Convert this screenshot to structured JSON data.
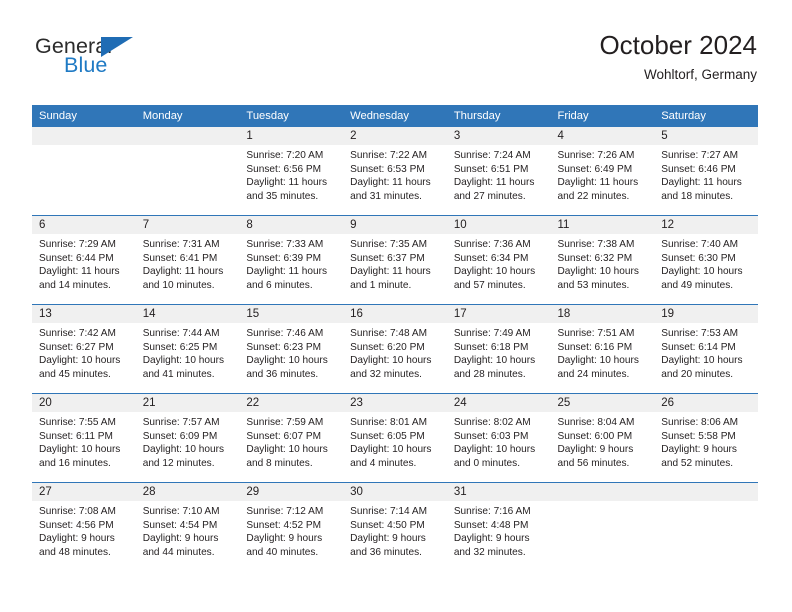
{
  "brand": {
    "line1": "General",
    "line2": "Blue",
    "triangle_color": "#1f6cb4",
    "blue_color": "#1f7ac4"
  },
  "header": {
    "title": "October 2024",
    "subtitle": "Wohltorf, Germany"
  },
  "theme": {
    "header_bg": "#3076b8",
    "daynum_bg": "#f0f0f0",
    "text": "#231f20"
  },
  "weekday_headers": [
    "Sunday",
    "Monday",
    "Tuesday",
    "Wednesday",
    "Thursday",
    "Friday",
    "Saturday"
  ],
  "labels": {
    "sunrise_prefix": "Sunrise:",
    "sunset_prefix": "Sunset:",
    "daylight_prefix": "Daylight:"
  },
  "weeks": [
    [
      {
        "day": "",
        "sunrise": "",
        "sunset": "",
        "daylight_1": "",
        "daylight_2": ""
      },
      {
        "day": "",
        "sunrise": "",
        "sunset": "",
        "daylight_1": "",
        "daylight_2": ""
      },
      {
        "day": "1",
        "sunrise": "Sunrise: 7:20 AM",
        "sunset": "Sunset: 6:56 PM",
        "daylight_1": "Daylight: 11 hours",
        "daylight_2": "and 35 minutes."
      },
      {
        "day": "2",
        "sunrise": "Sunrise: 7:22 AM",
        "sunset": "Sunset: 6:53 PM",
        "daylight_1": "Daylight: 11 hours",
        "daylight_2": "and 31 minutes."
      },
      {
        "day": "3",
        "sunrise": "Sunrise: 7:24 AM",
        "sunset": "Sunset: 6:51 PM",
        "daylight_1": "Daylight: 11 hours",
        "daylight_2": "and 27 minutes."
      },
      {
        "day": "4",
        "sunrise": "Sunrise: 7:26 AM",
        "sunset": "Sunset: 6:49 PM",
        "daylight_1": "Daylight: 11 hours",
        "daylight_2": "and 22 minutes."
      },
      {
        "day": "5",
        "sunrise": "Sunrise: 7:27 AM",
        "sunset": "Sunset: 6:46 PM",
        "daylight_1": "Daylight: 11 hours",
        "daylight_2": "and 18 minutes."
      }
    ],
    [
      {
        "day": "6",
        "sunrise": "Sunrise: 7:29 AM",
        "sunset": "Sunset: 6:44 PM",
        "daylight_1": "Daylight: 11 hours",
        "daylight_2": "and 14 minutes."
      },
      {
        "day": "7",
        "sunrise": "Sunrise: 7:31 AM",
        "sunset": "Sunset: 6:41 PM",
        "daylight_1": "Daylight: 11 hours",
        "daylight_2": "and 10 minutes."
      },
      {
        "day": "8",
        "sunrise": "Sunrise: 7:33 AM",
        "sunset": "Sunset: 6:39 PM",
        "daylight_1": "Daylight: 11 hours",
        "daylight_2": "and 6 minutes."
      },
      {
        "day": "9",
        "sunrise": "Sunrise: 7:35 AM",
        "sunset": "Sunset: 6:37 PM",
        "daylight_1": "Daylight: 11 hours",
        "daylight_2": "and 1 minute."
      },
      {
        "day": "10",
        "sunrise": "Sunrise: 7:36 AM",
        "sunset": "Sunset: 6:34 PM",
        "daylight_1": "Daylight: 10 hours",
        "daylight_2": "and 57 minutes."
      },
      {
        "day": "11",
        "sunrise": "Sunrise: 7:38 AM",
        "sunset": "Sunset: 6:32 PM",
        "daylight_1": "Daylight: 10 hours",
        "daylight_2": "and 53 minutes."
      },
      {
        "day": "12",
        "sunrise": "Sunrise: 7:40 AM",
        "sunset": "Sunset: 6:30 PM",
        "daylight_1": "Daylight: 10 hours",
        "daylight_2": "and 49 minutes."
      }
    ],
    [
      {
        "day": "13",
        "sunrise": "Sunrise: 7:42 AM",
        "sunset": "Sunset: 6:27 PM",
        "daylight_1": "Daylight: 10 hours",
        "daylight_2": "and 45 minutes."
      },
      {
        "day": "14",
        "sunrise": "Sunrise: 7:44 AM",
        "sunset": "Sunset: 6:25 PM",
        "daylight_1": "Daylight: 10 hours",
        "daylight_2": "and 41 minutes."
      },
      {
        "day": "15",
        "sunrise": "Sunrise: 7:46 AM",
        "sunset": "Sunset: 6:23 PM",
        "daylight_1": "Daylight: 10 hours",
        "daylight_2": "and 36 minutes."
      },
      {
        "day": "16",
        "sunrise": "Sunrise: 7:48 AM",
        "sunset": "Sunset: 6:20 PM",
        "daylight_1": "Daylight: 10 hours",
        "daylight_2": "and 32 minutes."
      },
      {
        "day": "17",
        "sunrise": "Sunrise: 7:49 AM",
        "sunset": "Sunset: 6:18 PM",
        "daylight_1": "Daylight: 10 hours",
        "daylight_2": "and 28 minutes."
      },
      {
        "day": "18",
        "sunrise": "Sunrise: 7:51 AM",
        "sunset": "Sunset: 6:16 PM",
        "daylight_1": "Daylight: 10 hours",
        "daylight_2": "and 24 minutes."
      },
      {
        "day": "19",
        "sunrise": "Sunrise: 7:53 AM",
        "sunset": "Sunset: 6:14 PM",
        "daylight_1": "Daylight: 10 hours",
        "daylight_2": "and 20 minutes."
      }
    ],
    [
      {
        "day": "20",
        "sunrise": "Sunrise: 7:55 AM",
        "sunset": "Sunset: 6:11 PM",
        "daylight_1": "Daylight: 10 hours",
        "daylight_2": "and 16 minutes."
      },
      {
        "day": "21",
        "sunrise": "Sunrise: 7:57 AM",
        "sunset": "Sunset: 6:09 PM",
        "daylight_1": "Daylight: 10 hours",
        "daylight_2": "and 12 minutes."
      },
      {
        "day": "22",
        "sunrise": "Sunrise: 7:59 AM",
        "sunset": "Sunset: 6:07 PM",
        "daylight_1": "Daylight: 10 hours",
        "daylight_2": "and 8 minutes."
      },
      {
        "day": "23",
        "sunrise": "Sunrise: 8:01 AM",
        "sunset": "Sunset: 6:05 PM",
        "daylight_1": "Daylight: 10 hours",
        "daylight_2": "and 4 minutes."
      },
      {
        "day": "24",
        "sunrise": "Sunrise: 8:02 AM",
        "sunset": "Sunset: 6:03 PM",
        "daylight_1": "Daylight: 10 hours",
        "daylight_2": "and 0 minutes."
      },
      {
        "day": "25",
        "sunrise": "Sunrise: 8:04 AM",
        "sunset": "Sunset: 6:00 PM",
        "daylight_1": "Daylight: 9 hours",
        "daylight_2": "and 56 minutes."
      },
      {
        "day": "26",
        "sunrise": "Sunrise: 8:06 AM",
        "sunset": "Sunset: 5:58 PM",
        "daylight_1": "Daylight: 9 hours",
        "daylight_2": "and 52 minutes."
      }
    ],
    [
      {
        "day": "27",
        "sunrise": "Sunrise: 7:08 AM",
        "sunset": "Sunset: 4:56 PM",
        "daylight_1": "Daylight: 9 hours",
        "daylight_2": "and 48 minutes."
      },
      {
        "day": "28",
        "sunrise": "Sunrise: 7:10 AM",
        "sunset": "Sunset: 4:54 PM",
        "daylight_1": "Daylight: 9 hours",
        "daylight_2": "and 44 minutes."
      },
      {
        "day": "29",
        "sunrise": "Sunrise: 7:12 AM",
        "sunset": "Sunset: 4:52 PM",
        "daylight_1": "Daylight: 9 hours",
        "daylight_2": "and 40 minutes."
      },
      {
        "day": "30",
        "sunrise": "Sunrise: 7:14 AM",
        "sunset": "Sunset: 4:50 PM",
        "daylight_1": "Daylight: 9 hours",
        "daylight_2": "and 36 minutes."
      },
      {
        "day": "31",
        "sunrise": "Sunrise: 7:16 AM",
        "sunset": "Sunset: 4:48 PM",
        "daylight_1": "Daylight: 9 hours",
        "daylight_2": "and 32 minutes."
      },
      {
        "day": "",
        "sunrise": "",
        "sunset": "",
        "daylight_1": "",
        "daylight_2": ""
      },
      {
        "day": "",
        "sunrise": "",
        "sunset": "",
        "daylight_1": "",
        "daylight_2": ""
      }
    ]
  ]
}
